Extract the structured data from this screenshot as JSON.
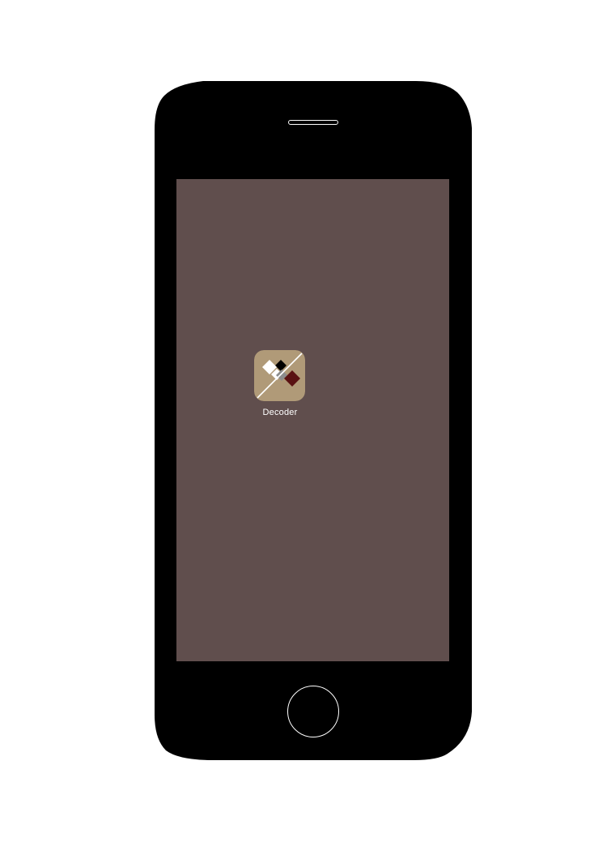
{
  "home_screen": {
    "apps": [
      {
        "label": "Decoder",
        "icon": "decoder-diamonds-icon"
      }
    ]
  },
  "colors": {
    "phone_body": "#000000",
    "screen_wallpaper": "#604e4d",
    "icon_background": "#b09a78",
    "icon_diamond_white": "#ffffff",
    "icon_diamond_black": "#000000",
    "icon_diamond_gray": "#8c8c8c",
    "icon_diamond_maroon": "#5a1212"
  }
}
